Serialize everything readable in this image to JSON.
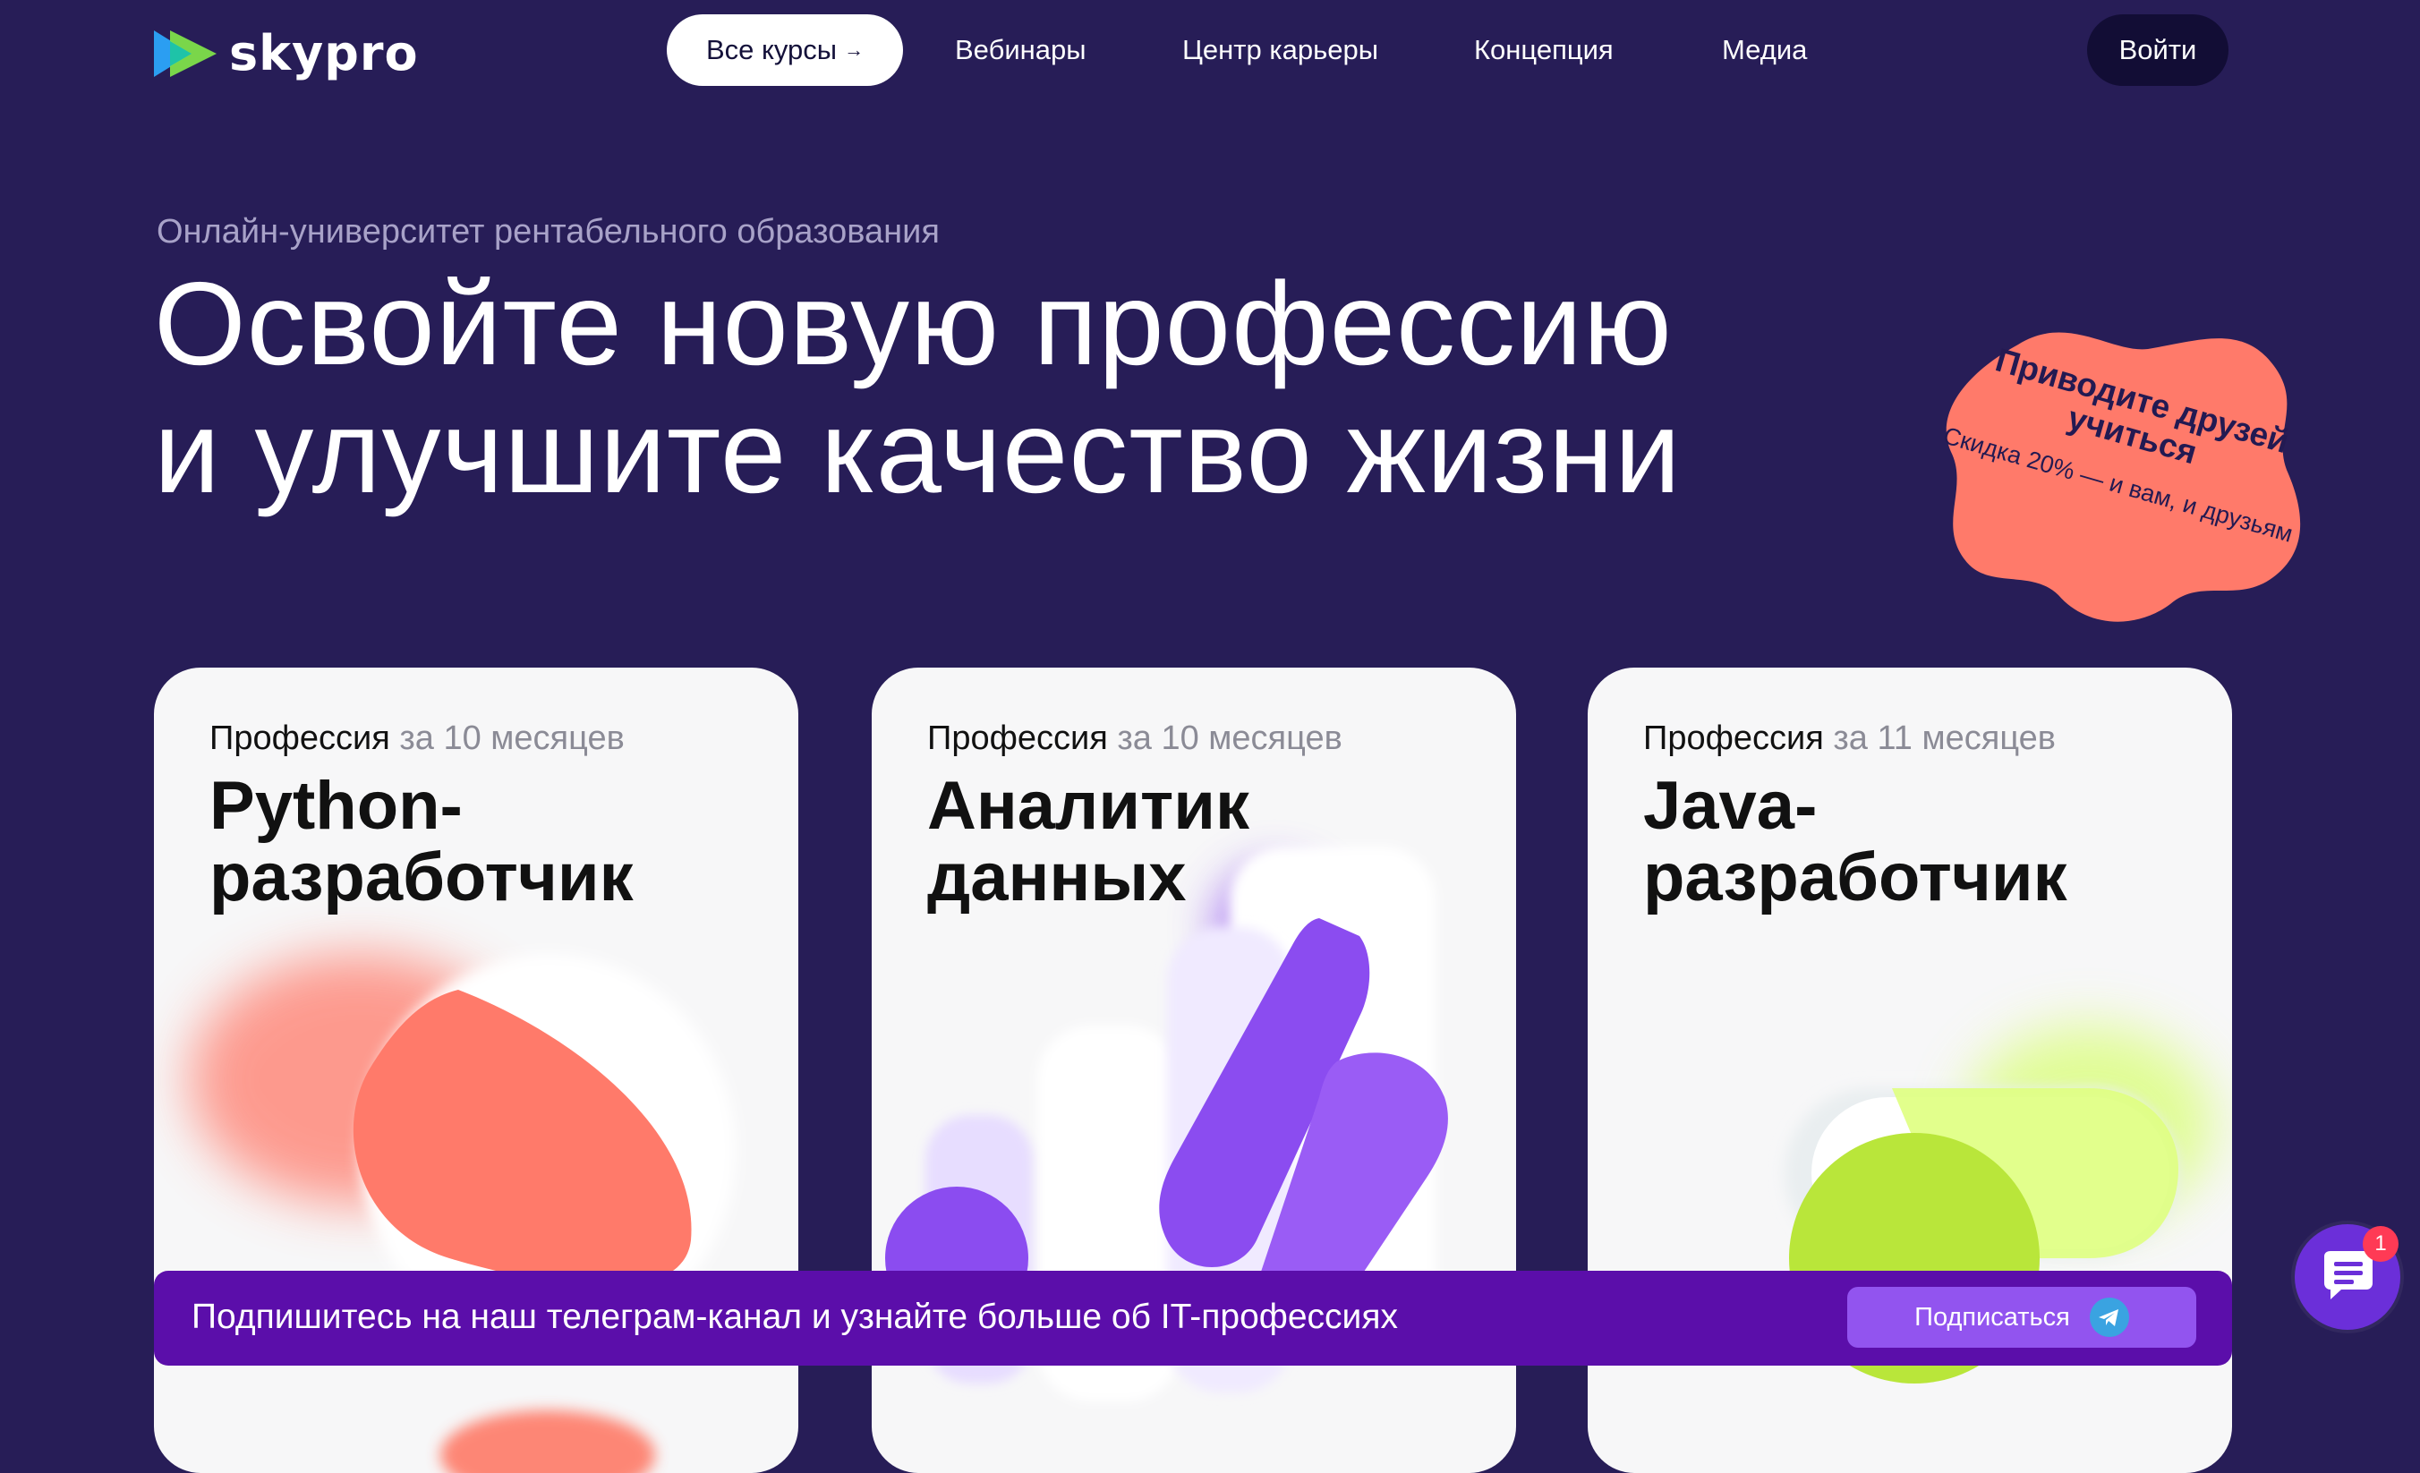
{
  "header": {
    "logo_text": "skypro",
    "nav": {
      "courses": "Все курсы",
      "webinars": "Вебинары",
      "career": "Центр карьеры",
      "concept": "Концепция",
      "media": "Медиа"
    },
    "login": "Войти"
  },
  "hero": {
    "eyebrow": "Онлайн-университет рентабельного образования",
    "title_line1": "Освойте новую профессию",
    "title_line2": "и улучшите качество жизни"
  },
  "badge": {
    "title": "Приводите друзей учиться",
    "subtitle": "Скидка 20% — и вам, и друзьям"
  },
  "cards": [
    {
      "meta_label": "Профессия",
      "duration": "за 10 месяцев",
      "title_line1": "Python-",
      "title_line2": "разработчик",
      "accent": "#ff7a6a"
    },
    {
      "meta_label": "Профессия",
      "duration": "за 10 месяцев",
      "title_line1": "Аналитик",
      "title_line2": "данных",
      "accent": "#8b4cf0"
    },
    {
      "meta_label": "Профессия",
      "duration": "за 11 месяцев",
      "title_line1": "Java-",
      "title_line2": "разработчик",
      "accent": "#b9e63a"
    }
  ],
  "banner": {
    "text": "Подпишитесь на наш телеграм-канал и узнайте больше об IT-профессиях",
    "button": "Подписаться"
  },
  "chat": {
    "unread": "1"
  },
  "colors": {
    "background": "#271d57",
    "banner": "#5b0eaa",
    "badge": "#ff7a6a",
    "button_dark": "#120d35"
  }
}
